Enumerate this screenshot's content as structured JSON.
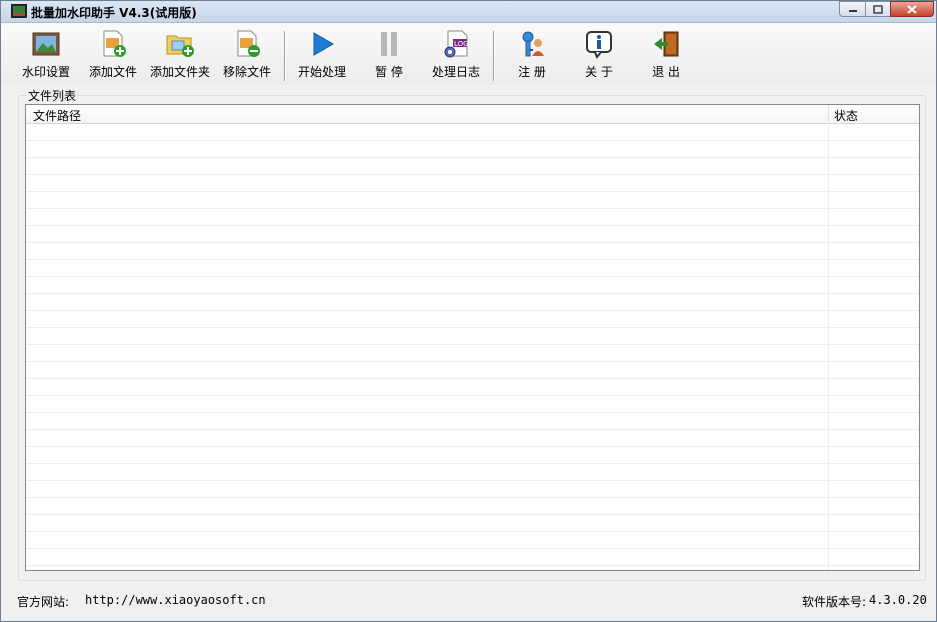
{
  "window": {
    "title": "批量加水印助手 V4.3(试用版)"
  },
  "toolbar": {
    "watermark_settings": "水印设置",
    "add_file": "添加文件",
    "add_folder": "添加文件夹",
    "remove_file": "移除文件",
    "start": "开始处理",
    "pause": "暂 停",
    "log": "处理日志",
    "register": "注 册",
    "about": "关 于",
    "exit": "退 出"
  },
  "file_list": {
    "group_label": "文件列表",
    "columns": [
      "文件路径",
      "状态"
    ],
    "rows": []
  },
  "status_bar": {
    "website_label": "官方网站:",
    "website_url": "http://www.xiaoyaosoft.cn",
    "version_label": "软件版本号:",
    "version": "4.3.0.20"
  },
  "colors": {
    "accent_blue": "#1e7ad6",
    "exit_green": "#2e8b2e"
  }
}
